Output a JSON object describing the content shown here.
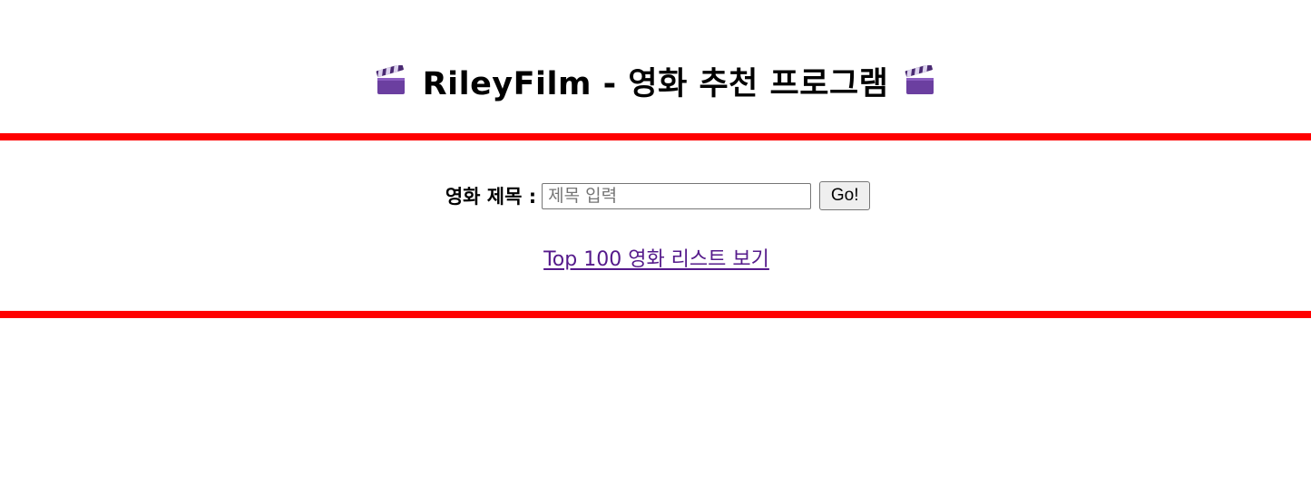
{
  "header": {
    "title": "RileyFilm - 영화 추천 프로그램",
    "left_icon": "clapper-board-icon",
    "right_icon": "clapper-board-icon"
  },
  "search": {
    "label": "영화 제목 :",
    "placeholder": "제목 입력",
    "value": "",
    "button_label": "Go!"
  },
  "links": {
    "top100_label": "Top 100 영화 리스트 보기"
  },
  "colors": {
    "divider": "#ff0000",
    "visited_link": "#551a8b",
    "clapper_body": "#6b3fa0"
  }
}
